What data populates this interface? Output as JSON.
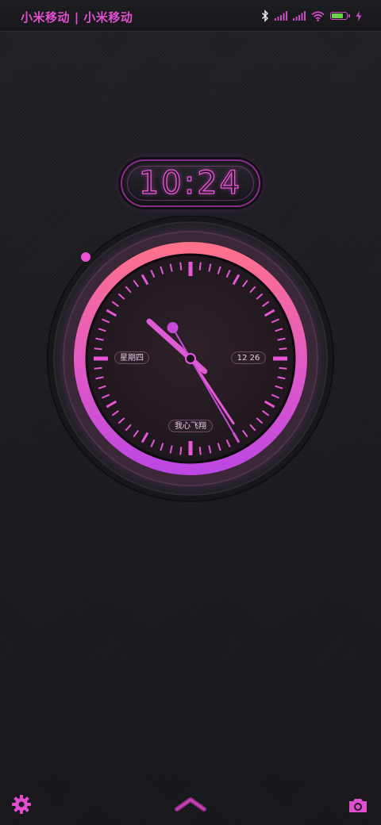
{
  "status_bar": {
    "carrier": "小米移动 | 小米移动",
    "battery_level": 0.85,
    "icons": [
      "bluetooth-icon",
      "signal-icon",
      "signal-icon",
      "wifi-icon",
      "battery-icon",
      "charging-icon"
    ]
  },
  "digital_clock": {
    "time": "10:24"
  },
  "analog_clock": {
    "weekday": "星期四",
    "date": "12 26",
    "label": "我心飞翔",
    "hour": 10,
    "minute": 24,
    "second": 25
  },
  "bottom_bar": {
    "icons": [
      "settings-gear-icon",
      "swipe-up-chevron-icon",
      "camera-icon"
    ]
  },
  "colors": {
    "accent": "#e956d8",
    "ring_top": "#ff6f8a",
    "ring_bottom": "#c24be0",
    "background": "#1b1a1e"
  }
}
